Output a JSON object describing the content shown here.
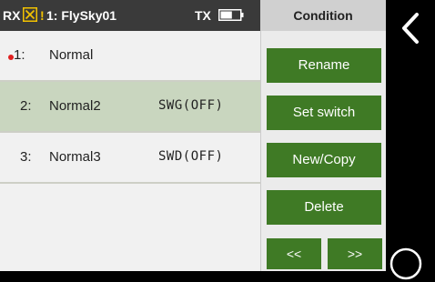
{
  "status": {
    "rx_label": "RX",
    "warning": "!",
    "model_name": "1: FlySky01",
    "tx_label": "TX",
    "tx_battery_fraction": 0.6
  },
  "heading": "Condition",
  "conditions": [
    {
      "num": "1:",
      "name": "Normal",
      "switch": ""
    },
    {
      "num": "2:",
      "name": "Normal2",
      "switch": "SWG(OFF)"
    },
    {
      "num": "3:",
      "name": "Normal3",
      "switch": "SWD(OFF)"
    }
  ],
  "buttons": {
    "rename": "Rename",
    "set_switch": "Set switch",
    "new_copy": "New/Copy",
    "delete": "Delete",
    "prev": "<<",
    "next": ">>"
  },
  "colors": {
    "accent_green": "#3f7a25",
    "selected_row": "#c9d6bf",
    "warning": "#f2c200",
    "active_dot": "#e02020"
  },
  "icons": {
    "back": "chevron-left-icon",
    "rotate": "circle-icon"
  }
}
